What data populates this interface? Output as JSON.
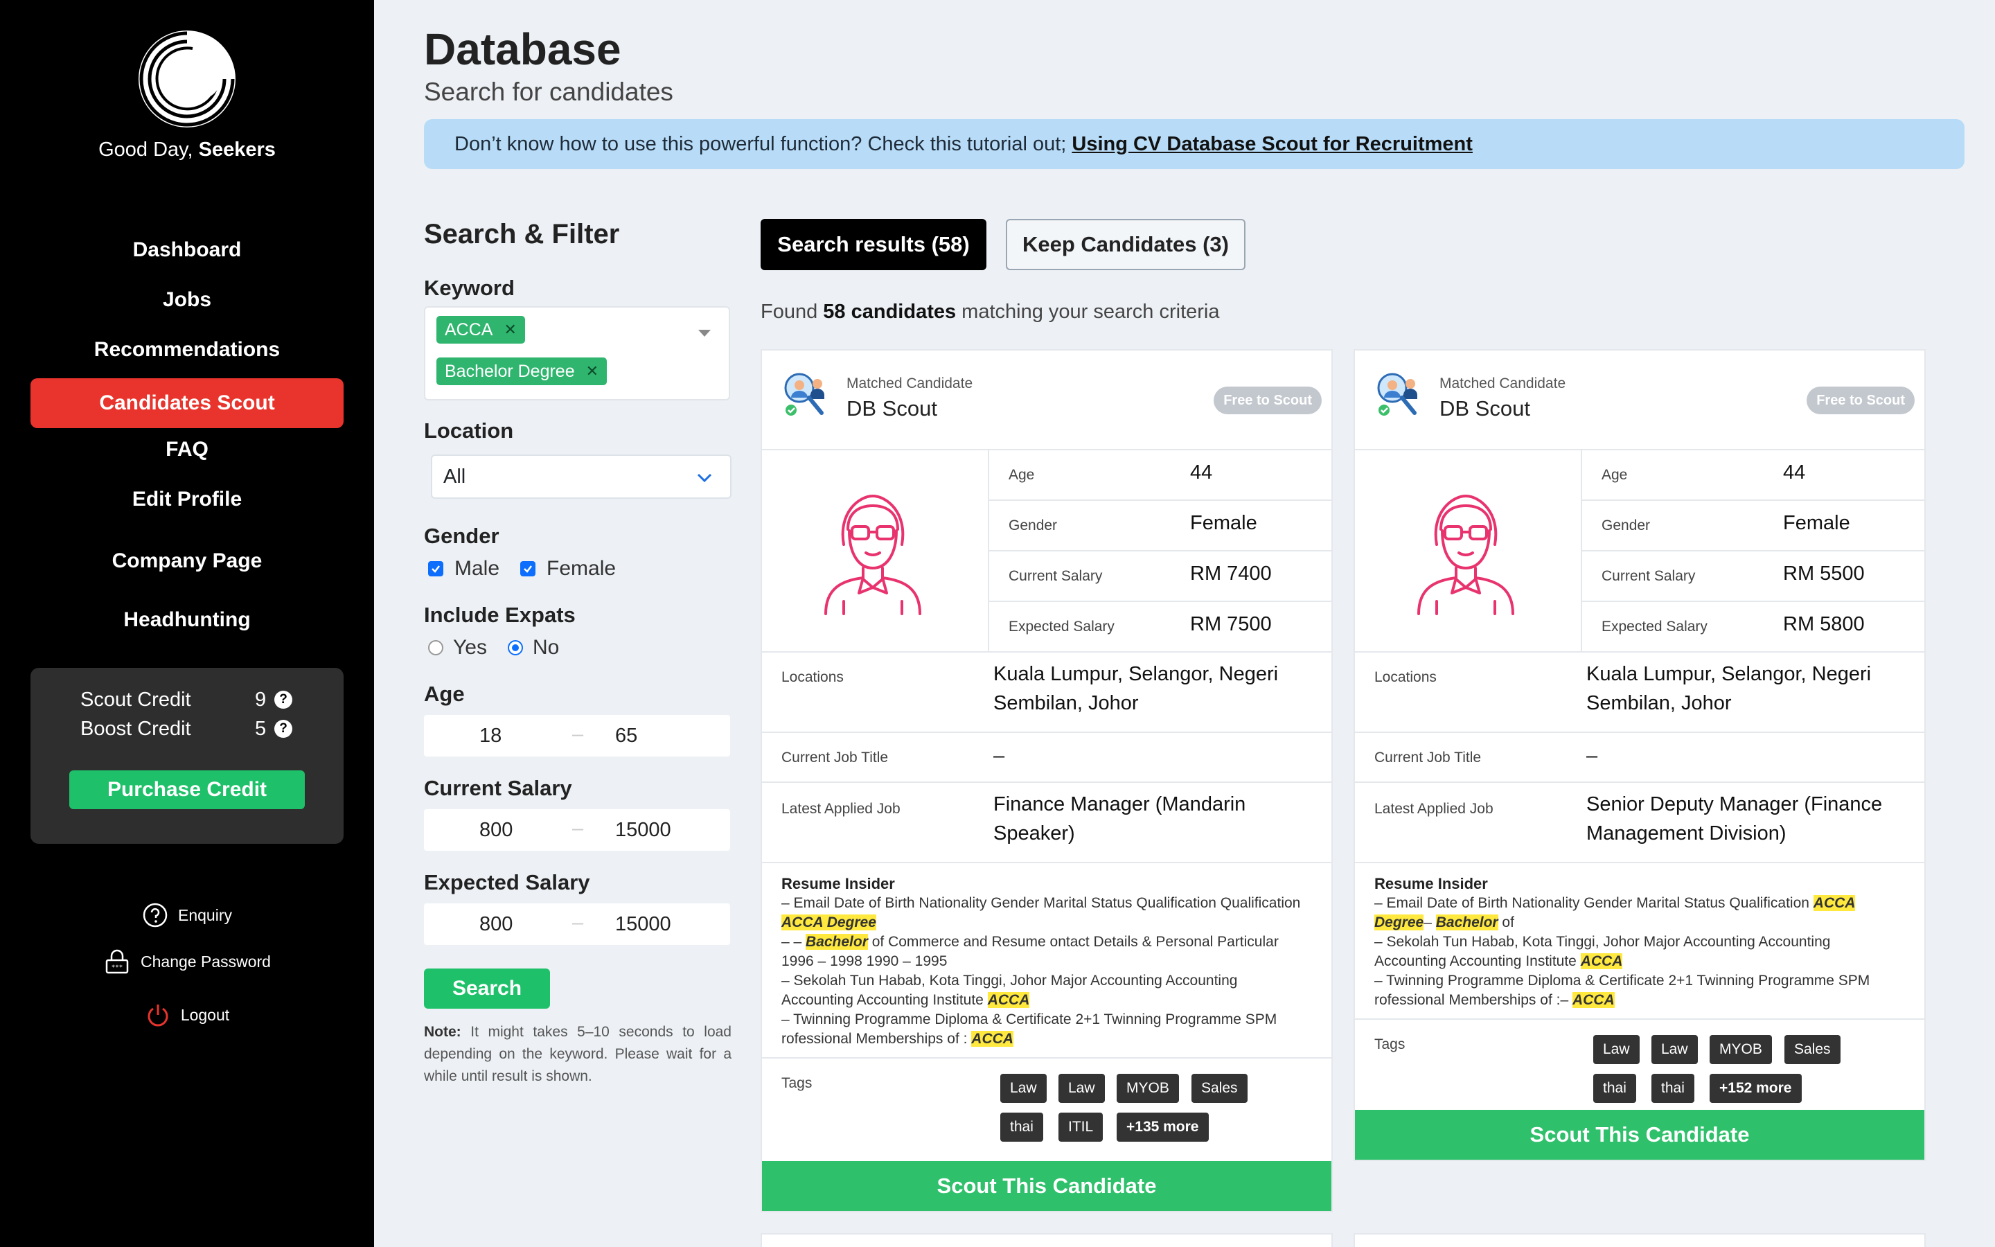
{
  "sidebar": {
    "greeting_prefix": "Good Day, ",
    "greeting_name": "Seekers",
    "nav": [
      {
        "label": "Dashboard"
      },
      {
        "label": "Jobs"
      },
      {
        "label": "Recommendations"
      },
      {
        "label": "Candidates Scout"
      },
      {
        "label": "FAQ"
      },
      {
        "label": "Edit Profile"
      },
      {
        "label": "Company Page"
      },
      {
        "label": "Headhunting"
      }
    ],
    "credits": {
      "scout_label": "Scout Credit",
      "scout_value": "9",
      "boost_label": "Boost Credit",
      "boost_value": "5",
      "purchase_label": "Purchase Credit"
    },
    "footer": {
      "enquiry": "Enquiry",
      "change_password": "Change Password",
      "logout": "Logout"
    }
  },
  "header": {
    "title": "Database",
    "subtitle": "Search for candidates",
    "tutorial_text": "Don’t know how to use this powerful function? Check this tutorial out; ",
    "tutorial_link": "Using CV Database Scout for Recruitment"
  },
  "filter": {
    "title": "Search & Filter",
    "keyword_label": "Keyword",
    "keywords": [
      "ACCA",
      "Bachelor Degree"
    ],
    "location_label": "Location",
    "location_value": "All",
    "gender_label": "Gender",
    "gender_male": "Male",
    "gender_female": "Female",
    "expats_label": "Include Expats",
    "expats_yes": "Yes",
    "expats_no": "No",
    "age_label": "Age",
    "age_min": "18",
    "age_max": "65",
    "current_salary_label": "Current Salary",
    "current_salary_min": "800",
    "current_salary_max": "15000",
    "expected_salary_label": "Expected Salary",
    "expected_salary_min": "800",
    "expected_salary_max": "15000",
    "range_sep": "–",
    "search_label": "Search",
    "note_bold": "Note:",
    "note_text": " It might takes 5–10 seconds to load depending on the keyword. Please wait for a while until result is shown."
  },
  "results": {
    "tab_results": "Search results (58)",
    "tab_keep": "Keep Candidates (3)",
    "found_prefix": "Found ",
    "found_count": "58 candidates",
    "found_suffix": " matching your search criteria"
  },
  "labels": {
    "matched": "Matched Candidate",
    "db_scout": "DB Scout",
    "free": "Free to Scout",
    "age": "Age",
    "gender": "Gender",
    "current_salary": "Current Salary",
    "expected_salary": "Expected Salary",
    "locations": "Locations",
    "current_job_title": "Current Job Title",
    "latest_applied_job": "Latest Applied Job",
    "resume_insider": "Resume Insider",
    "tags": "Tags",
    "scout_button": "Scout This Candidate"
  },
  "candidates": [
    {
      "age": "44",
      "gender": "Female",
      "current_salary": "RM 7400",
      "expected_salary": "RM 7500",
      "locations": "Kuala Lumpur, Selangor, Negeri Sembilan, Johor",
      "current_job_title": "–",
      "latest_applied_job": "Finance Manager (Mandarin Speaker)",
      "resume": [
        [
          {
            "t": "– Email Date of Birth Nationality Gender Marital Status Qualification Qualification "
          },
          {
            "t": "ACCA Degree",
            "h": true
          }
        ],
        [
          {
            "t": "– – "
          },
          {
            "t": "Bachelor",
            "h": true
          },
          {
            "t": " of Commerce and Resume ontact Details & Personal Particular 1996 – 1998 1990 – 1995"
          }
        ],
        [
          {
            "t": "– Sekolah Tun Habab, Kota Tinggi, Johor Major Accounting Accounting Accounting Accounting Institute "
          },
          {
            "t": "ACCA",
            "h": true
          }
        ],
        [
          {
            "t": "– Twinning Programme Diploma & Certificate 2+1 Twinning Programme SPM rofessional Memberships of : "
          },
          {
            "t": "ACCA",
            "h": true
          }
        ]
      ],
      "tags_row1": [
        "Law",
        "Law",
        "MYOB",
        "Sales"
      ],
      "tags_row2": [
        "thai",
        "ITIL"
      ],
      "more": "+135 more"
    },
    {
      "age": "44",
      "gender": "Female",
      "current_salary": "RM 5500",
      "expected_salary": "RM 5800",
      "locations": "Kuala Lumpur, Selangor, Negeri Sembilan, Johor",
      "current_job_title": "–",
      "latest_applied_job": "Senior Deputy Manager (Finance Management Division)",
      "resume": [
        [
          {
            "t": "– Email Date of Birth Nationality Gender Marital Status Qualification "
          },
          {
            "t": "ACCA Degree",
            "h": true
          },
          {
            "t": "– "
          },
          {
            "t": "Bachelor",
            "h": true
          },
          {
            "t": " of"
          }
        ],
        [
          {
            "t": "– Sekolah Tun Habab, Kota Tinggi, Johor Major Accounting Accounting Accounting Accounting Institute "
          },
          {
            "t": "ACCA",
            "h": true
          }
        ],
        [
          {
            "t": "– Twinning Programme Diploma & Certificate 2+1 Twinning Programme SPM rofessional Memberships of :– "
          },
          {
            "t": "ACCA",
            "h": true
          }
        ]
      ],
      "tags_row1": [
        "Law",
        "Law",
        "MYOB",
        "Sales"
      ],
      "tags_row2": [
        "thai",
        "thai"
      ],
      "more": "+152 more"
    }
  ],
  "colors": {
    "sidebar_bg": "#000000",
    "active_nav": "#e8342c",
    "success": "#1ec16a",
    "tutorial_bg": "#b8dcf7",
    "highlight": "#ffe93f",
    "avatar_stroke": "#e8336e"
  }
}
